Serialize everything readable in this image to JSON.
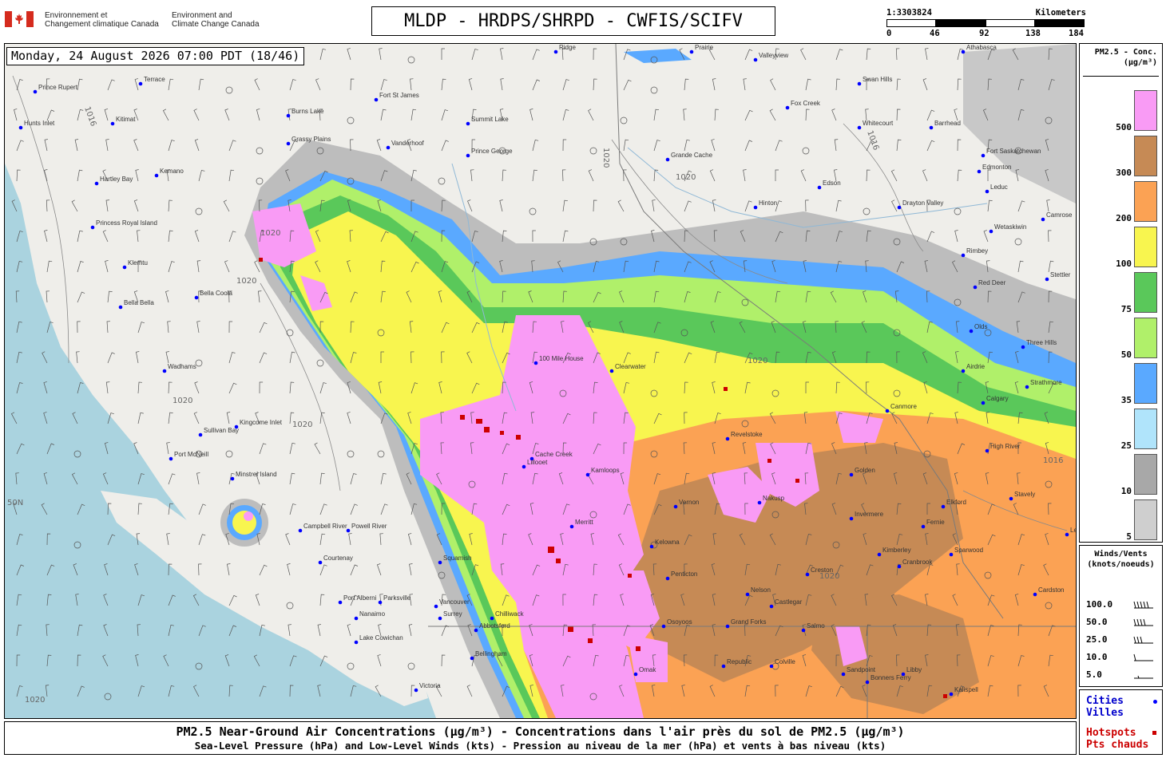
{
  "header": {
    "dept_fr": "Environnement et\nChangement climatique Canada",
    "dept_en": "Environment and\nClimate Change Canada",
    "title": "MLDP - HRDPS/SHRPD - CWFIS/SCIFV",
    "scale": {
      "ratio": "1:3303824",
      "unit": "Kilometers",
      "ticks": [
        "0",
        "46",
        "92",
        "138",
        "184"
      ]
    }
  },
  "map": {
    "timestamp": "Monday, 24 August 2026 07:00 PDT (18/46)",
    "lat_label": "50N",
    "isobar_labels": [
      "1016",
      "1020",
      "1020",
      "1020",
      "1020",
      "1020",
      "1020",
      "1020",
      "1016",
      "1020",
      "1016",
      "1020"
    ],
    "cities": [
      {
        "name": "Prince Rupert"
      },
      {
        "name": "Terrace"
      },
      {
        "name": "Hunts Inlet"
      },
      {
        "name": "Kitimat"
      },
      {
        "name": "Burns Lake"
      },
      {
        "name": "Fort St James"
      },
      {
        "name": "Grassy Plains"
      },
      {
        "name": "Vanderhoof"
      },
      {
        "name": "Summit Lake"
      },
      {
        "name": "Prince George"
      },
      {
        "name": "Grande Cache"
      },
      {
        "name": "Ridge"
      },
      {
        "name": "Prairie"
      },
      {
        "name": "Valleyview"
      },
      {
        "name": "Athabasca"
      },
      {
        "name": "Swan Hills"
      },
      {
        "name": "Fox Creek"
      },
      {
        "name": "Whitecourt"
      },
      {
        "name": "Barrhead"
      },
      {
        "name": "Fort Saskatchewan"
      },
      {
        "name": "Edmonton"
      },
      {
        "name": "Edson"
      },
      {
        "name": "Leduc"
      },
      {
        "name": "Drayton Valley"
      },
      {
        "name": "Hinton"
      },
      {
        "name": "Wetaskiwin"
      },
      {
        "name": "Camrose"
      },
      {
        "name": "Kemano"
      },
      {
        "name": "Hartley Bay"
      },
      {
        "name": "Princess Royal Island"
      },
      {
        "name": "Klemtu"
      },
      {
        "name": "Bella Coola"
      },
      {
        "name": "Bella Bella"
      },
      {
        "name": "Wadhams"
      },
      {
        "name": "Kingcome Inlet"
      },
      {
        "name": "Sullivan Bay"
      },
      {
        "name": "Port McNeill"
      },
      {
        "name": "Minstrel Island"
      },
      {
        "name": "Campbell River"
      },
      {
        "name": "Powell River"
      },
      {
        "name": "Courtenay"
      },
      {
        "name": "Port Alberni"
      },
      {
        "name": "Parksville"
      },
      {
        "name": "Nanaimo"
      },
      {
        "name": "Lake Cowichan"
      },
      {
        "name": "Victoria"
      },
      {
        "name": "Squamish"
      },
      {
        "name": "Vancouver"
      },
      {
        "name": "Surrey"
      },
      {
        "name": "Abbotsford"
      },
      {
        "name": "Bellingham"
      },
      {
        "name": "Chilliwack"
      },
      {
        "name": "100 Mile House"
      },
      {
        "name": "Clearwater"
      },
      {
        "name": "Cache Creek"
      },
      {
        "name": "Lillooet"
      },
      {
        "name": "Kamloops"
      },
      {
        "name": "Merritt"
      },
      {
        "name": "Vernon"
      },
      {
        "name": "Kelowna"
      },
      {
        "name": "Penticton"
      },
      {
        "name": "Osoyoos"
      },
      {
        "name": "Omak"
      },
      {
        "name": "Republic"
      },
      {
        "name": "Colville"
      },
      {
        "name": "Grand Forks"
      },
      {
        "name": "Castlegar"
      },
      {
        "name": "Nelson"
      },
      {
        "name": "Nakusp"
      },
      {
        "name": "Revelstoke"
      },
      {
        "name": "Golden"
      },
      {
        "name": "Canmore"
      },
      {
        "name": "Calgary"
      },
      {
        "name": "High River"
      },
      {
        "name": "Airdrie"
      },
      {
        "name": "Red Deer"
      },
      {
        "name": "Stettler"
      },
      {
        "name": "Three Hills"
      },
      {
        "name": "Olds"
      },
      {
        "name": "Strathmore"
      },
      {
        "name": "Stavely"
      },
      {
        "name": "Lethbridge"
      },
      {
        "name": "Cardston"
      },
      {
        "name": "Fernie"
      },
      {
        "name": "Cranbrook"
      },
      {
        "name": "Kimberley"
      },
      {
        "name": "Invermere"
      },
      {
        "name": "Sparwood"
      },
      {
        "name": "Libby"
      },
      {
        "name": "Kalispell"
      },
      {
        "name": "Sandpoint"
      },
      {
        "name": "Bonners Ferry"
      },
      {
        "name": "Creston"
      },
      {
        "name": "Salmo"
      },
      {
        "name": "Elkford"
      },
      {
        "name": "Rimbey"
      }
    ]
  },
  "legend_pm": {
    "title": "PM2.5 - Conc.\n(µg/m³)",
    "bins": [
      {
        "label": "500",
        "color": "#f99bf5"
      },
      {
        "label": "300",
        "color": "#c68a55"
      },
      {
        "label": "200",
        "color": "#fba254"
      },
      {
        "label": "100",
        "color": "#f8f54f"
      },
      {
        "label": "75",
        "color": "#5ac85a"
      },
      {
        "label": "50",
        "color": "#b0f06a"
      },
      {
        "label": "35",
        "color": "#5aa9ff"
      },
      {
        "label": "25",
        "color": "#b0e4fb"
      },
      {
        "label": "10",
        "color": "#a8a8a8"
      },
      {
        "label": "5",
        "color": "#cfcfcf"
      }
    ]
  },
  "legend_wind": {
    "title": "Winds/Vents\n(knots/noeuds)",
    "rows": [
      "100.0",
      "50.0",
      "25.0",
      "10.0",
      "5.0"
    ]
  },
  "legend_symbols": {
    "cities_label": "Cities\nVilles",
    "hotspots_label": "Hotspots\nPts chauds",
    "city_color": "#0000ff",
    "hotspot_color": "#cc0000"
  },
  "footer": {
    "line1": "PM2.5 Near-Ground Air Concentrations (µg/m³) - Concentrations dans l'air près du sol de PM2.5 (µg/m³)",
    "line2": "Sea-Level Pressure (hPa) and Low-Level Winds (kts) - Pression au niveau de la mer (hPa) et vents à bas niveau (kts)"
  }
}
